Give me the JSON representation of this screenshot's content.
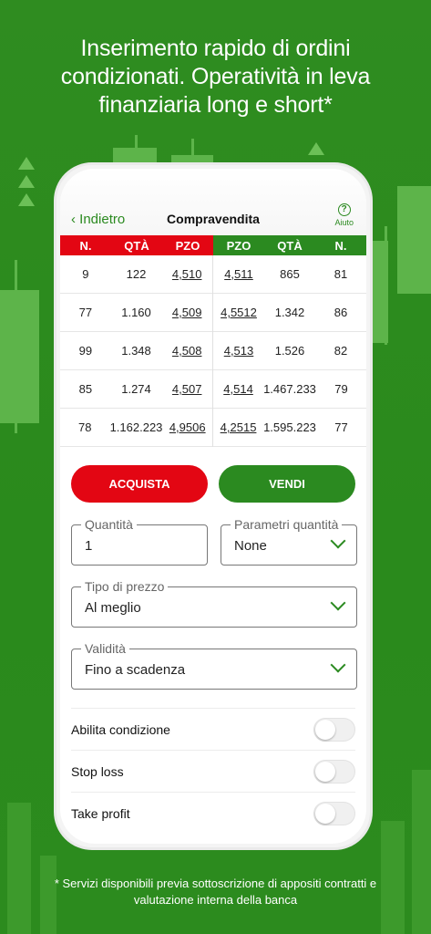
{
  "headline": {
    "line1": "Inserimento rapido di ordini",
    "line2": "condizionati. Operatività in leva",
    "line3": "finanziaria long e short*"
  },
  "footnote": {
    "line1": "* Servizi disponibili previa sottoscrizione di appositi contratti e",
    "line2": "valutazione interna della banca"
  },
  "app": {
    "back_label": "Indietro",
    "title": "Compravendita",
    "help_label": "Aiuto",
    "help_icon": "?"
  },
  "book": {
    "buy_headers": [
      "N.",
      "QTÀ",
      "PZO"
    ],
    "sell_headers": [
      "PZO",
      "QTÀ",
      "N."
    ],
    "buy_rows": [
      [
        "9",
        "122",
        "4,510"
      ],
      [
        "77",
        "1.160",
        "4,509"
      ],
      [
        "99",
        "1.348",
        "4,508"
      ],
      [
        "85",
        "1.274",
        "4,507"
      ],
      [
        "78",
        "1.162.223",
        "4,9506"
      ]
    ],
    "sell_rows": [
      [
        "4,511",
        "865",
        "81"
      ],
      [
        "4,5512",
        "1.342",
        "86"
      ],
      [
        "4,513",
        "1.526",
        "82"
      ],
      [
        "4,514",
        "1.467.233",
        "79"
      ],
      [
        "4,2515",
        "1.595.223",
        "77"
      ]
    ]
  },
  "actions": {
    "buy_label": "ACQUISTA",
    "sell_label": "VENDI"
  },
  "form": {
    "quantity_label": "Quantità",
    "quantity_value": "1",
    "qty_params_label": "Parametri quantità",
    "qty_params_value": "None",
    "price_type_label": "Tipo di prezzo",
    "price_type_value": "Al meglio",
    "validity_label": "Validità",
    "validity_value": "Fino a scadenza"
  },
  "toggles": {
    "condition_label": "Abilita condizione",
    "stop_loss_label": "Stop loss",
    "take_profit_label": "Take profit"
  },
  "colors": {
    "background": "#2e8a1f",
    "buy": "#e30613",
    "sell": "#2b8a20"
  }
}
